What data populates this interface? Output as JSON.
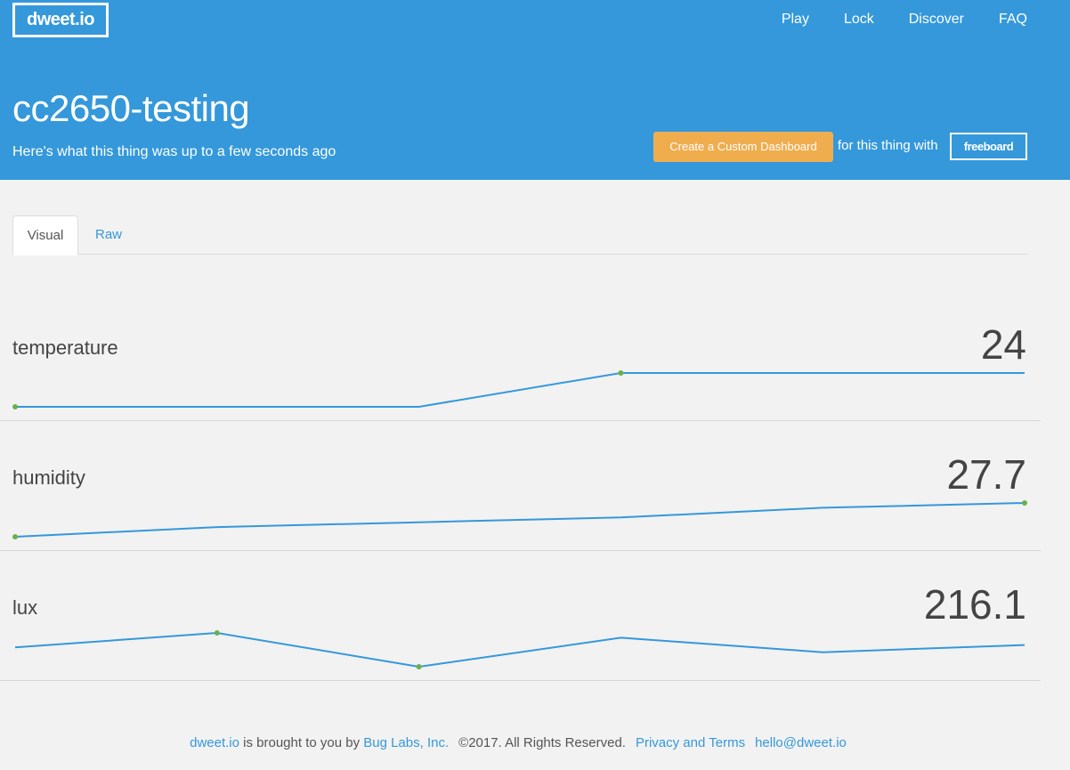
{
  "header": {
    "logo": "dweet.io",
    "nav": [
      "Play",
      "Lock",
      "Discover",
      "FAQ"
    ],
    "title": "cc2650-testing",
    "subtitle": "Here's what this thing was up to a few seconds ago",
    "dashboard_button": "Create a Custom Dashboard",
    "dashboard_suffix": "for this thing with",
    "freeboard_logo": "freeboard"
  },
  "tabs": [
    "Visual",
    "Raw"
  ],
  "metrics": [
    {
      "name": "temperature",
      "value": "24",
      "series": [
        23.5,
        23.5,
        23.5,
        24,
        24,
        24
      ]
    },
    {
      "name": "humidity",
      "value": "27.7",
      "series": [
        27.0,
        27.2,
        27.3,
        27.4,
        27.6,
        27.7
      ]
    },
    {
      "name": "lux",
      "value": "216.1",
      "series": [
        216.0,
        216.6,
        215.2,
        216.4,
        215.8,
        216.1
      ]
    }
  ],
  "footer": {
    "brand_link": "dweet.io",
    "brought_text": " is brought to you by ",
    "company_link": "Bug Labs, Inc.",
    "copyright": "©2017. All Rights Reserved.",
    "privacy_link": "Privacy and Terms",
    "email_link": "hello@dweet.io"
  },
  "colors": {
    "header_bg": "#3498db",
    "button_orange": "#f0ad4e",
    "link_blue": "#3498db",
    "sparkline": "#3498db",
    "marker_green": "#6ab04c",
    "page_bg": "#f2f2f2"
  }
}
